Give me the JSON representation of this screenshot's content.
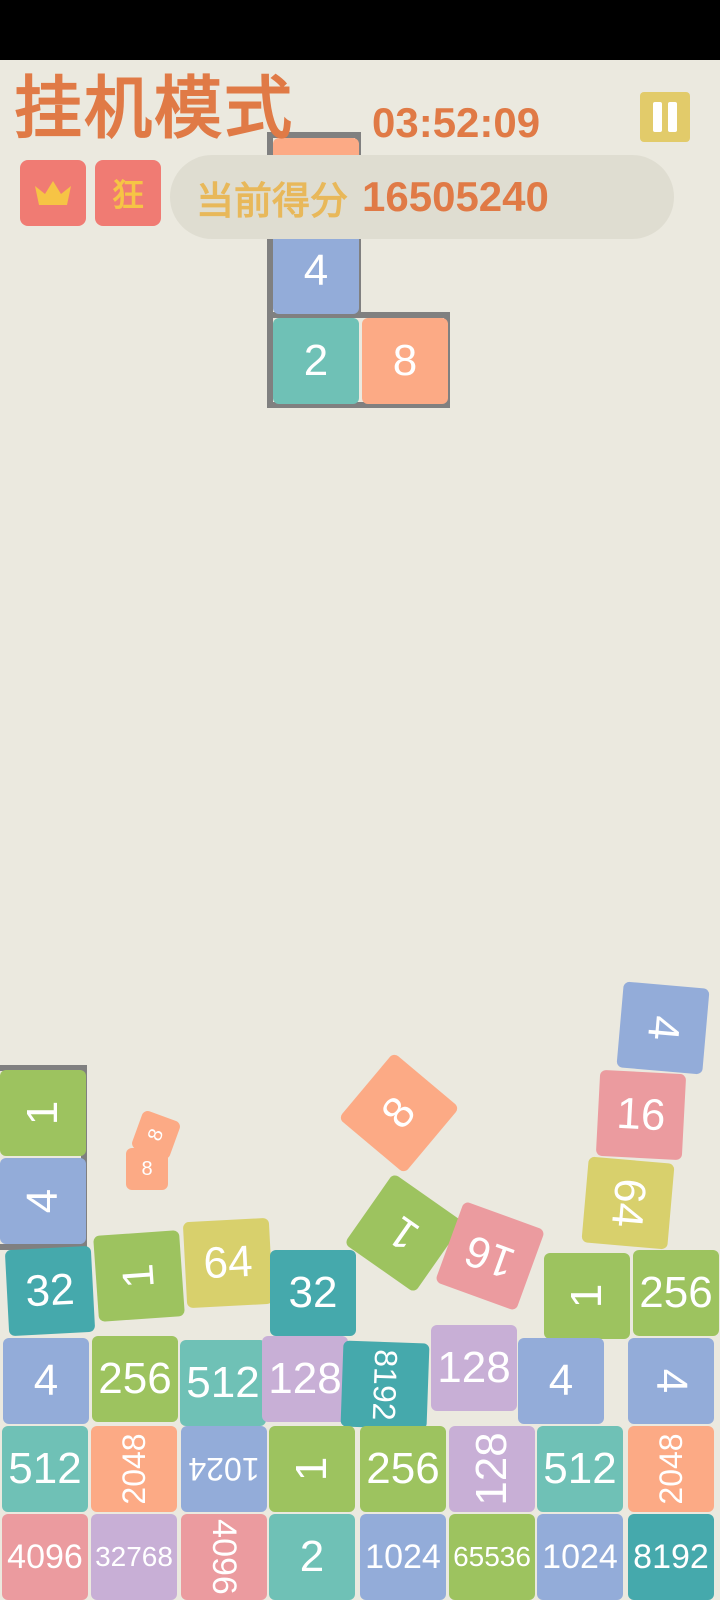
{
  "header": {
    "title": "挂机模式",
    "timer": "03:52:09",
    "badge_mad": "狂",
    "score_label": "当前得分",
    "score_value": "16505240"
  },
  "colors": {
    "background": "#ebe9df",
    "accent": "#e07a46",
    "score_label": "#e8b85a",
    "badge": "#f07b73",
    "pause": "#e2cb6a",
    "piece_frame": "#808080"
  },
  "icons": [
    "crown-icon",
    "pause-icon"
  ],
  "falling_piece": [
    "8",
    "4",
    "2",
    "8"
  ],
  "board_tiles": [
    {
      "value": "4",
      "color": "c-4"
    },
    {
      "value": "16",
      "color": "c-16"
    },
    {
      "value": "8",
      "color": "c-8"
    },
    {
      "value": "64",
      "color": "c-64"
    },
    {
      "value": "1",
      "color": "c-1"
    },
    {
      "value": "16",
      "color": "c-16"
    },
    {
      "value": "1",
      "color": "c-1"
    },
    {
      "value": "4",
      "color": "c-4"
    },
    {
      "value": "8",
      "color": "c-8"
    },
    {
      "value": "8",
      "color": "c-8"
    },
    {
      "value": "32",
      "color": "c-32"
    },
    {
      "value": "1",
      "color": "c-1"
    },
    {
      "value": "64",
      "color": "c-64"
    },
    {
      "value": "32",
      "color": "c-32"
    },
    {
      "value": "1",
      "color": "c-1"
    },
    {
      "value": "256",
      "color": "c-256"
    },
    {
      "value": "4",
      "color": "c-4"
    },
    {
      "value": "256",
      "color": "c-256"
    },
    {
      "value": "512",
      "color": "c-512"
    },
    {
      "value": "128",
      "color": "c-128"
    },
    {
      "value": "8192",
      "color": "c-8192"
    },
    {
      "value": "128",
      "color": "c-128"
    },
    {
      "value": "4",
      "color": "c-4"
    },
    {
      "value": "4",
      "color": "c-4"
    },
    {
      "value": "512",
      "color": "c-512"
    },
    {
      "value": "2048",
      "color": "c-2048"
    },
    {
      "value": "1024",
      "color": "c-1024"
    },
    {
      "value": "1",
      "color": "c-1"
    },
    {
      "value": "256",
      "color": "c-256"
    },
    {
      "value": "128",
      "color": "c-128"
    },
    {
      "value": "512",
      "color": "c-512"
    },
    {
      "value": "2048",
      "color": "c-2048"
    },
    {
      "value": "4096",
      "color": "c-4096"
    },
    {
      "value": "32768",
      "color": "c-32768"
    },
    {
      "value": "4096",
      "color": "c-4096"
    },
    {
      "value": "2",
      "color": "c-2"
    },
    {
      "value": "1024",
      "color": "c-1024"
    },
    {
      "value": "65536",
      "color": "c-65536"
    },
    {
      "value": "1024",
      "color": "c-1024"
    },
    {
      "value": "8192",
      "color": "c-8192"
    }
  ]
}
